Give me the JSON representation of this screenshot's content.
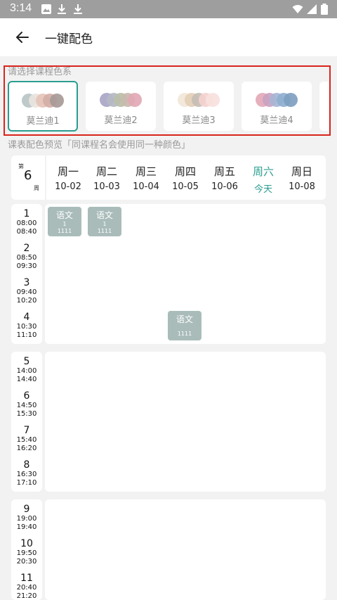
{
  "status_bar": {
    "time": "3:14"
  },
  "app_bar": {
    "title": "一键配色"
  },
  "palette_section": {
    "label": "请选择课程色系",
    "selected_color": "#2a9d8f",
    "options": [
      {
        "name": "莫兰迪1",
        "colors": [
          "#b9c4c5",
          "#e9e4df",
          "#e6c4b9",
          "#d2aea6",
          "#a79a97"
        ]
      },
      {
        "name": "莫兰迪2",
        "colors": [
          "#a9a6c5",
          "#b5b9c4",
          "#b8bfa8",
          "#c9b8ae",
          "#e2a8b4"
        ]
      },
      {
        "name": "莫兰迪3",
        "colors": [
          "#f1e7d9",
          "#e4cfb7",
          "#c6bdb5",
          "#f4d2cf",
          "#f7e1dd"
        ]
      },
      {
        "name": "莫兰迪4",
        "colors": [
          "#e3a9b6",
          "#c9a3c2",
          "#a8b6d4",
          "#8fb0d0",
          "#7f9fc0"
        ]
      }
    ]
  },
  "preview_section": {
    "label": "课表配色预览「同课程名会使用同一种颜色」"
  },
  "week": {
    "prefix": "第",
    "number": "6",
    "suffix": "周"
  },
  "days": [
    {
      "name": "周一",
      "date": "10-02",
      "today": false
    },
    {
      "name": "周二",
      "date": "10-03",
      "today": false
    },
    {
      "name": "周三",
      "date": "10-04",
      "today": false
    },
    {
      "name": "周四",
      "date": "10-05",
      "today": false
    },
    {
      "name": "周五",
      "date": "10-06",
      "today": false
    },
    {
      "name": "周六",
      "date": "今天",
      "today": true
    },
    {
      "name": "周日",
      "date": "10-08",
      "today": false
    }
  ],
  "periods": [
    {
      "num": "1",
      "start": "08:00",
      "end": "08:40"
    },
    {
      "num": "2",
      "start": "08:50",
      "end": "09:30"
    },
    {
      "num": "3",
      "start": "09:40",
      "end": "10:20"
    },
    {
      "num": "4",
      "start": "10:30",
      "end": "11:10"
    },
    {
      "num": "5",
      "start": "14:00",
      "end": "14:40"
    },
    {
      "num": "6",
      "start": "14:50",
      "end": "15:30"
    },
    {
      "num": "7",
      "start": "15:40",
      "end": "16:20"
    },
    {
      "num": "8",
      "start": "16:30",
      "end": "17:10"
    },
    {
      "num": "9",
      "start": "19:00",
      "end": "19:40"
    },
    {
      "num": "10",
      "start": "19:50",
      "end": "20:30"
    },
    {
      "num": "11",
      "start": "20:40",
      "end": "21:20"
    }
  ],
  "courses": [
    {
      "name": "语文",
      "line1": "1",
      "line2": "1111"
    },
    {
      "name": "语文",
      "line1": "1",
      "line2": "1111"
    },
    {
      "name": "语文",
      "line1": "",
      "line2": "1111"
    }
  ]
}
